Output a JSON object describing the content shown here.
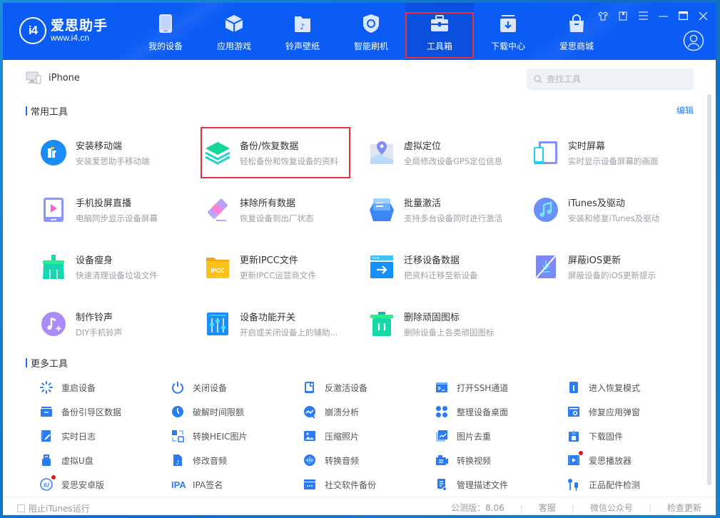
{
  "app": {
    "title": "爱思助手",
    "url": "www.i4.cn",
    "logo_text": "i4"
  },
  "nav": [
    {
      "label": "我的设备",
      "icon": "phone-icon"
    },
    {
      "label": "应用游戏",
      "icon": "cube-icon"
    },
    {
      "label": "铃声壁纸",
      "icon": "music-folder-icon"
    },
    {
      "label": "智能刷机",
      "icon": "shield-refresh-icon"
    },
    {
      "label": "工具箱",
      "icon": "toolbox-icon",
      "active": true
    },
    {
      "label": "下载中心",
      "icon": "download-icon"
    },
    {
      "label": "爱思商城",
      "icon": "shopping-bag-icon"
    }
  ],
  "window_controls": [
    "skin-icon",
    "feedback-icon",
    "menu-icon",
    "minimize-icon",
    "maximize-icon",
    "close-icon"
  ],
  "device": {
    "name": "iPhone"
  },
  "search": {
    "placeholder": "查找工具",
    "value": ""
  },
  "common_tools": {
    "title": "常用工具",
    "edit_label": "编辑",
    "items": [
      {
        "name": "安装移动端",
        "desc": "安装爱思助手移动端",
        "icon": "i4-mobile-icon"
      },
      {
        "name": "备份/恢复数据",
        "desc": "轻松备份和恢复设备的资料",
        "icon": "layers-backup-icon",
        "highlighted": true
      },
      {
        "name": "虚拟定位",
        "desc": "全局修改设备GPS定位信息",
        "icon": "map-pin-icon"
      },
      {
        "name": "实时屏幕",
        "desc": "实时显示设备屏幕的画面",
        "icon": "screen-mirror-icon"
      },
      {
        "name": "手机投屏直播",
        "desc": "电脑同步显示设备屏幕",
        "icon": "phone-play-icon"
      },
      {
        "name": "抹除所有数据",
        "desc": "恢复设备到出厂状态",
        "icon": "eraser-icon"
      },
      {
        "name": "批量激活",
        "desc": "支持多台设备同时进行激活",
        "icon": "inbox-icon"
      },
      {
        "name": "iTunes及驱动",
        "desc": "安装和修复iTunes及驱动",
        "icon": "itunes-note-icon"
      },
      {
        "name": "设备瘦身",
        "desc": "快速清理设备垃圾文件",
        "icon": "broom-icon"
      },
      {
        "name": "更新IPCC文件",
        "desc": "更新IPCC运营商文件",
        "icon": "ipcc-folder-icon",
        "icon_text": "IPCC"
      },
      {
        "name": "迁移设备数据",
        "desc": "把资料迁移至新设备",
        "icon": "migrate-arrow-icon"
      },
      {
        "name": "屏蔽iOS更新",
        "desc": "屏蔽设备的iOS更新提示",
        "icon": "block-update-icon"
      },
      {
        "name": "制作铃声",
        "desc": "DIY手机铃声",
        "icon": "ringtone-add-icon"
      },
      {
        "name": "设备功能开关",
        "desc": "开启或关闭设备上的辅助...",
        "icon": "sliders-icon"
      },
      {
        "name": "删除顽固图标",
        "desc": "删除设备上各类顽固图标",
        "icon": "trash-icon"
      }
    ]
  },
  "more_tools": {
    "title": "更多工具",
    "items": [
      {
        "label": "重启设备",
        "icon": "restart-spinner-icon"
      },
      {
        "label": "关闭设备",
        "icon": "power-icon"
      },
      {
        "label": "反激活设备",
        "icon": "deactivate-phone-icon"
      },
      {
        "label": "打开SSH通道",
        "icon": "terminal-icon"
      },
      {
        "label": "进入恢复模式",
        "icon": "recovery-mode-icon"
      },
      {
        "label": "备份引导区数据",
        "icon": "boot-backup-icon"
      },
      {
        "label": "破解时间限额",
        "icon": "clock-icon"
      },
      {
        "label": "崩溃分析",
        "icon": "crash-chart-icon"
      },
      {
        "label": "整理设备桌面",
        "icon": "grid-dots-icon"
      },
      {
        "label": "修复应用弹窗",
        "icon": "fix-popup-icon"
      },
      {
        "label": "实时日志",
        "icon": "log-pen-icon"
      },
      {
        "label": "转换HEIC图片",
        "icon": "convert-image-icon"
      },
      {
        "label": "压缩照片",
        "icon": "photo-icon"
      },
      {
        "label": "图片去重",
        "icon": "duplicate-photo-icon"
      },
      {
        "label": "下载固件",
        "icon": "firmware-download-icon"
      },
      {
        "label": "虚拟U盘",
        "icon": "usb-drive-icon"
      },
      {
        "label": "修改音频",
        "icon": "audio-file-icon"
      },
      {
        "label": "转换音频",
        "icon": "audio-convert-icon"
      },
      {
        "label": "转换视频",
        "icon": "video-convert-icon"
      },
      {
        "label": "爱思播放器",
        "icon": "player-icon",
        "badge": true
      },
      {
        "label": "爱思安卓版",
        "icon": "i4-android-icon",
        "badge": true
      },
      {
        "label": "IPA签名",
        "icon": "ipa-icon",
        "icon_text": "IPA"
      },
      {
        "label": "社交软件备份",
        "icon": "chat-backup-icon"
      },
      {
        "label": "管理描述文件",
        "icon": "profile-file-icon"
      },
      {
        "label": "正品配件检测",
        "icon": "earphone-check-icon"
      }
    ]
  },
  "footer": {
    "block_itunes_label": "阻止iTunes运行",
    "block_itunes_checked": false,
    "version_label": "公测版：8.06",
    "support_label": "客服",
    "wechat_label": "微信公众号",
    "check_update_label": "检查更新"
  },
  "colors": {
    "header_blue": "#0b5cf5",
    "accent_blue": "#1f6ff5",
    "highlight_red": "#e8323b"
  }
}
